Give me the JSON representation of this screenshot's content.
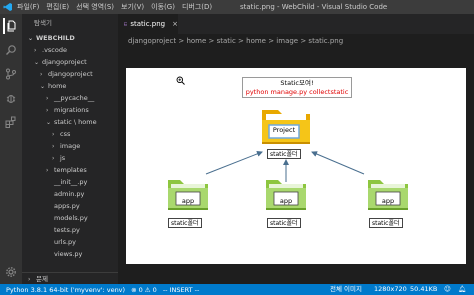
{
  "titlebar": {
    "menu": [
      "파일(F)",
      "편집(E)",
      "선택 영역(S)",
      "보기(V)",
      "이동(G)",
      "디버그(D)"
    ],
    "window_title": "static.png - WebChild - Visual Studio Code"
  },
  "sidebar": {
    "header": "탐색기",
    "root": "WEBCHILD",
    "items": [
      {
        "label": ".vscode",
        "arrow": "›",
        "indent": 1
      },
      {
        "label": "djangoproject",
        "arrow": "⌄",
        "indent": 1
      },
      {
        "label": "djangoproject",
        "arrow": "›",
        "indent": 2
      },
      {
        "label": "home",
        "arrow": "⌄",
        "indent": 2
      },
      {
        "label": "__pycache__",
        "arrow": "›",
        "indent": 3
      },
      {
        "label": "migrations",
        "arrow": "›",
        "indent": 3
      },
      {
        "label": "static \\ home",
        "arrow": "⌄",
        "indent": 3
      },
      {
        "label": "css",
        "arrow": "›",
        "indent": 4
      },
      {
        "label": "image",
        "arrow": "›",
        "indent": 4
      },
      {
        "label": "js",
        "arrow": "›",
        "indent": 4
      },
      {
        "label": "templates",
        "arrow": "›",
        "indent": 3
      },
      {
        "label": "__init__.py",
        "arrow": "",
        "indent": 3
      },
      {
        "label": "admin.py",
        "arrow": "",
        "indent": 3
      },
      {
        "label": "apps.py",
        "arrow": "",
        "indent": 3
      },
      {
        "label": "models.py",
        "arrow": "",
        "indent": 3
      },
      {
        "label": "tests.py",
        "arrow": "",
        "indent": 3
      },
      {
        "label": "urls.py",
        "arrow": "",
        "indent": 3
      },
      {
        "label": "views.py",
        "arrow": "",
        "indent": 3
      }
    ],
    "footer": "문제"
  },
  "tab": {
    "label": "static.png",
    "close": "×"
  },
  "breadcrumb": "djangoproject > home > static > home > image > static.png",
  "image": {
    "callout_line1": "Static모여!",
    "callout_line2": "python manage.py collectstatic",
    "center_folder_label": "Project",
    "center_box": "static폴더",
    "app_labels": [
      "app",
      "app",
      "app"
    ],
    "static_boxes": [
      "static폴더",
      "static폴더",
      "static폴더"
    ]
  },
  "statusbar": {
    "python": "Python 3.8.1 64-bit ('myvenv': venv)",
    "problems": "⊗ 0 ⚠ 0",
    "mode": "-- INSERT --",
    "zoom_label": "전체 이미지",
    "dimensions": "1280x720",
    "filesize": "50.41KB"
  },
  "colors": {
    "statusbar": "#007acc",
    "folder_green": "#8dc63f",
    "folder_yellow": "#f0b400",
    "arrow_blue": "#4a6f8f"
  }
}
